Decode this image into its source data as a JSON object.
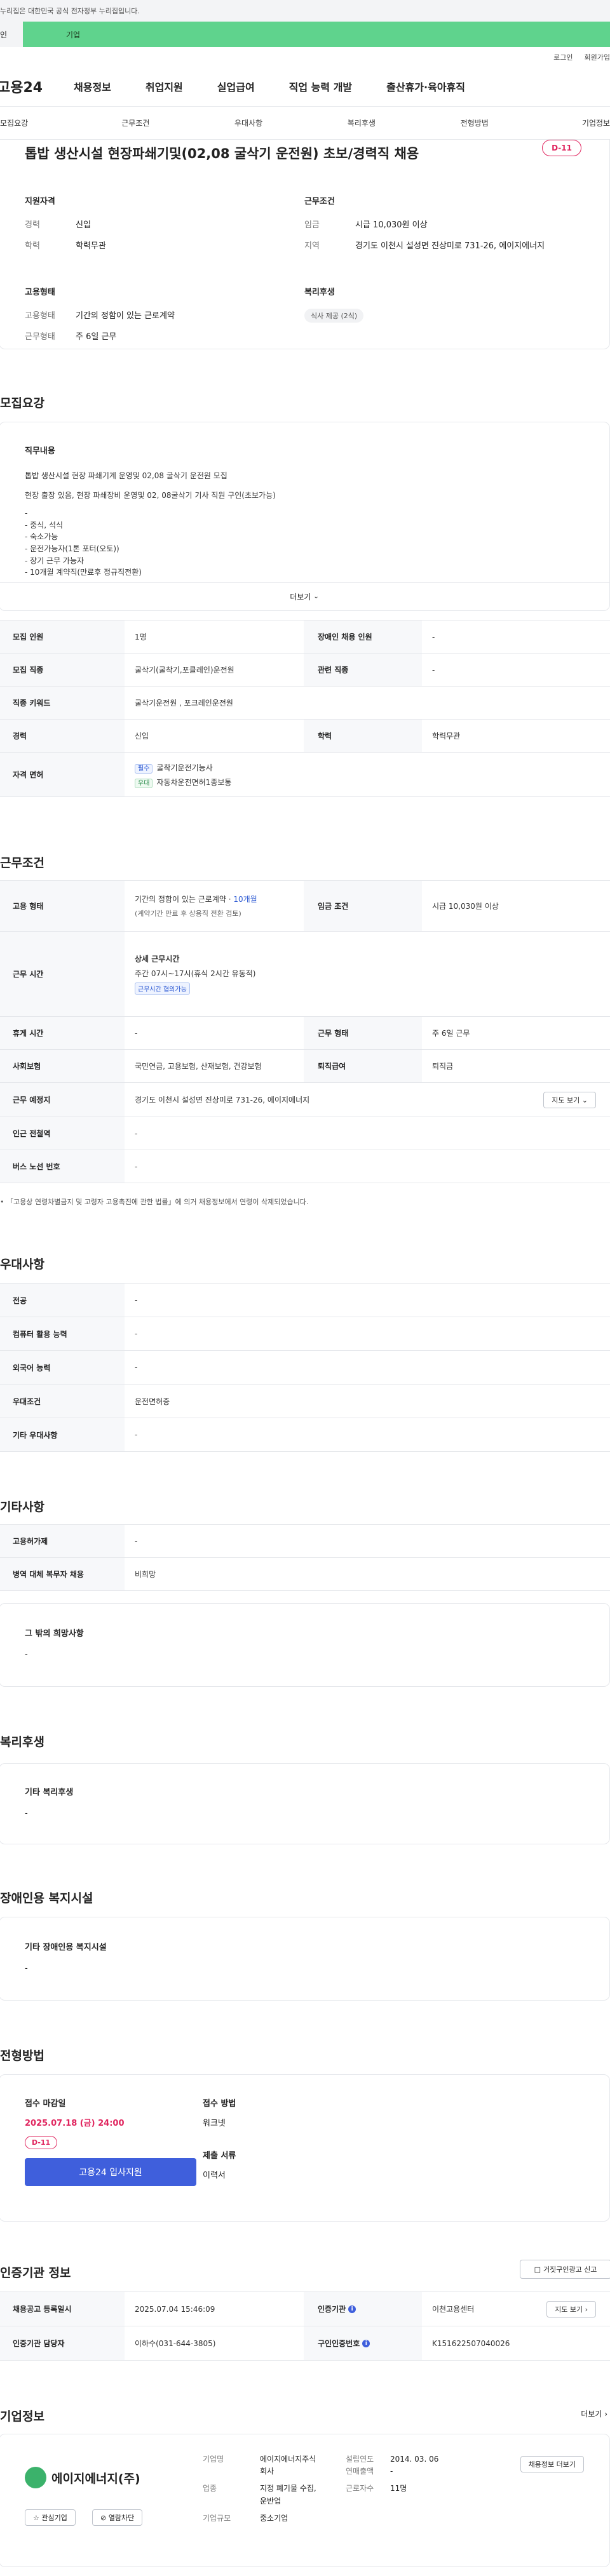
{
  "banner": {
    "text": "누리집은 대한민국 공식 전자정부 누리집입니다."
  },
  "notice": {
    "left": "인",
    "right": "기업"
  },
  "top_links": [
    "로그인",
    "회원가입"
  ],
  "gnb": {
    "logo": "고용24",
    "items": [
      "채용정보",
      "취업지원",
      "실업급여",
      "직업 능력 개발",
      "출산휴가·육아휴직"
    ]
  },
  "subnav": [
    "모집요강",
    "근무조건",
    "우대사항",
    "복리후생",
    "전형방법",
    "기업정보"
  ],
  "summary": {
    "title": "톱밥 생산시설 현장파쇄기및(02,08 굴삭기 운전원) 초보/경력직 채용",
    "dday": "D-11",
    "qual_head": "지원자격",
    "qual": [
      {
        "k": "경력",
        "v": "신입"
      },
      {
        "k": "학력",
        "v": "학력무관"
      }
    ],
    "cond_head": "근무조건",
    "cond": [
      {
        "k": "임금",
        "v": "시급 10,030원 이상"
      },
      {
        "k": "지역",
        "v": "경기도 이천시 설성면 진상미로 731-26, 에이지에너지"
      }
    ],
    "emp_head": "고용형태",
    "emp": [
      {
        "k": "고용형태",
        "v": "기간의 정함이 있는 근로계약"
      },
      {
        "k": "근무형태",
        "v": "주 6일 근무"
      }
    ],
    "welfare_head": "복리후생",
    "welfare_chip": "식사 제공 (2식)"
  },
  "recruit": {
    "section_title": "모집요강",
    "desc_head": "직무내용",
    "desc_lines": [
      "톱밥 생산시설 현장 파쇄기계 운영및 02,08 굴삭기 운전원 모집",
      "현장 출장 있음, 현장 파쇄장비 운영및 02, 08굴삭기 기사 직원 구인(초보가능)",
      "-",
      "- 중식, 석식",
      "- 숙소가능",
      "- 운전가능자(1톤 포터(오토))",
      "- 장기 근무 가능자",
      "- 10개월 계약직(만료후 정규직전환)"
    ],
    "more": "더보기",
    "rows": {
      "headcount_k": "모집 인원",
      "headcount_v": "1명",
      "disabled_k": "장애인 채용 인원",
      "disabled_v": "-",
      "job_k": "모집 직종",
      "job_v": "굴삭기(굴착기,포클레인)운전원",
      "related_k": "관련 직종",
      "related_v": "-",
      "keyword_k": "직종 키워드",
      "keyword_v": "굴삭기운전원 , 포크레인운전원",
      "career_k": "경력",
      "career_v": "신입",
      "edu_k": "학력",
      "edu_v": "학력무관",
      "license_k": "자격 면허",
      "license_items": [
        {
          "tag": "필수",
          "name": "굴착기운전기능사"
        },
        {
          "tag": "우대",
          "name": "자동차운전면허1종보통"
        }
      ]
    }
  },
  "condition": {
    "section_title": "근무조건",
    "emp_type_k": "고용 형태",
    "emp_type_v1": "기간의 정함이 있는 근로계약 · ",
    "emp_type_v1_highlight": "10개월",
    "emp_type_v2": "(계약기간 만료 후 상용직 전환 검토)",
    "wage_k": "임금 조건",
    "wage_v": "시급 10,030원 이상",
    "hours_k": "근무 시간",
    "hours_head": "상세 근무시간",
    "hours_v": "주간 07시~17시(휴식 2시간 유동적)",
    "hours_chip": "근무시간 협의가능",
    "rest_k": "휴게 시간",
    "rest_v": "-",
    "work_type_k": "근무 형태",
    "work_type_v": "주 6일 근무",
    "insurance_k": "사회보험",
    "insurance_v": "국민연금, 고용보험, 산재보험, 건강보험",
    "retire_k": "퇴직급여",
    "retire_v": "퇴직금",
    "place_k": "근무 예정지",
    "place_v": "경기도 이천시 설성면 진상미로 731-26, 에이지에너지",
    "map_btn": "지도 보기",
    "subway_k": "인근 전철역",
    "subway_v": "-",
    "bus_k": "버스 노선 번호",
    "bus_v": "-",
    "footnote": "「고용상 연령차별금지 및 고령자 고용촉진에 관한 법률」에 의거 채용정보에서 연령이 삭제되었습니다."
  },
  "preference": {
    "section_title": "우대사항",
    "rows": [
      {
        "k": "전공",
        "v": "-"
      },
      {
        "k": "컴퓨터 활용 능력",
        "v": "-"
      },
      {
        "k": "외국어 능력",
        "v": "-"
      },
      {
        "k": "우대조건",
        "v": "운전면허증"
      },
      {
        "k": "기타 우대사항",
        "v": "-"
      }
    ]
  },
  "etc": {
    "section_title": "기타사항",
    "rows": [
      {
        "k": "고용허가제",
        "v": "-"
      },
      {
        "k": "병역 대체 복무자 채용",
        "v": "비희망"
      }
    ],
    "other_head": "그 밖의 희망사항",
    "other_v": "-"
  },
  "welfare": {
    "section_title": "복리후생",
    "head": "기타 복리후생",
    "v": "-"
  },
  "disability": {
    "section_title": "장애인용 복지시설",
    "head": "기타 장애인용 복지시설",
    "v": "-"
  },
  "process": {
    "section_title": "전형방법",
    "deadline_head": "접수 마감일",
    "deadline_v": "2025.07.18 (금) 24:00",
    "dday": "D-11",
    "apply_btn": "고용24 입사지원",
    "method_head": "접수 방법",
    "method_v": "워크넷",
    "docs_head": "제출 서류",
    "docs_v": "이력서"
  },
  "agency": {
    "section_title": "인증기관 정보",
    "report_btn": "거짓구인광고 신고",
    "reg_date_k": "채용공고 등록일시",
    "reg_date_v": "2025.07.04 15:46:09",
    "agency_k": "인증기관",
    "agency_v": "이천고용센터",
    "manager_k": "인증기관 담당자",
    "manager_v": "이하수(031-644-3805)",
    "cert_k": "구인인증번호",
    "cert_v": "K151622507040026",
    "map_btn": "지도 보기"
  },
  "company": {
    "section_title": "기업정보",
    "more": "더보기",
    "logo_text": "에이지에너지(주)",
    "interest_btn": "관심기업",
    "block_btn": "열람차단",
    "name_k": "기업명",
    "name_v1": "에이지에너지주식",
    "name_v2": "회사",
    "founded_k": "설립연도",
    "founded_v": "2014. 03. 06",
    "sales_k": "연매출액",
    "sales_v": "-",
    "industry_k": "업종",
    "industry_v1": "지정 폐기물 수집,",
    "industry_v2": "운반업",
    "employees_k": "근로자수",
    "employees_v": "11명",
    "size_k": "기업규모",
    "size_v": "중소기업",
    "jobs_btn": "채용정보 더보기"
  }
}
